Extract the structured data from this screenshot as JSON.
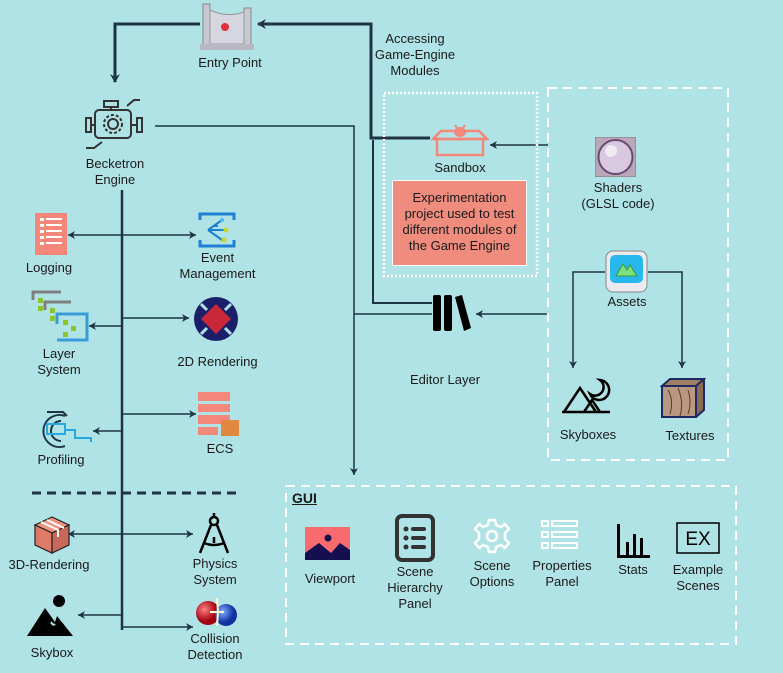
{
  "diagram": {
    "entry_point": "Entry Point",
    "engine": [
      "Becketron",
      "Engine"
    ],
    "accessing": [
      "Accessing",
      "Game-Engine",
      "Modules"
    ],
    "sandbox": "Sandbox",
    "sandbox_note": [
      "Experimentation",
      "project used to test",
      "different modules of",
      "the Game Engine"
    ],
    "shaders": [
      "Shaders",
      "(GLSL code)"
    ],
    "assets": "Assets",
    "skyboxes": "Skyboxes",
    "textures": "Textures",
    "editor_layer": "Editor Layer",
    "modules_left": [
      {
        "label": [
          "Logging"
        ]
      },
      {
        "label": [
          "Layer",
          "System"
        ]
      },
      {
        "label": [
          "Profiling"
        ]
      },
      {
        "label": [
          "3D-Rendering"
        ]
      },
      {
        "label": [
          "Skybox"
        ]
      }
    ],
    "modules_right": [
      {
        "label": [
          "Event",
          "Management"
        ]
      },
      {
        "label": [
          "2D Rendering"
        ]
      },
      {
        "label": [
          "ECS"
        ]
      },
      {
        "label": [
          "Physics",
          "System"
        ]
      },
      {
        "label": [
          "Collision",
          "Detection"
        ]
      }
    ],
    "gui": {
      "title": "GUI",
      "items": [
        {
          "label": [
            "Viewport"
          ],
          "icon": "image-icon"
        },
        {
          "label": [
            "Scene",
            "Hierarchy",
            "Panel"
          ],
          "icon": "list-icon"
        },
        {
          "label": [
            "Scene",
            "Options"
          ],
          "icon": "gear-icon"
        },
        {
          "label": [
            "Properties",
            "Panel"
          ],
          "icon": "properties-list-icon"
        },
        {
          "label": [
            "Stats"
          ],
          "icon": "bar-chart-icon"
        },
        {
          "label": [
            "Example",
            "Scenes"
          ],
          "icon": "ex-icon"
        }
      ]
    },
    "colors": {
      "background": "#b0e3e6",
      "line": "#1e3444",
      "note": "#f08c7e",
      "salmon": "#f4877a"
    }
  }
}
